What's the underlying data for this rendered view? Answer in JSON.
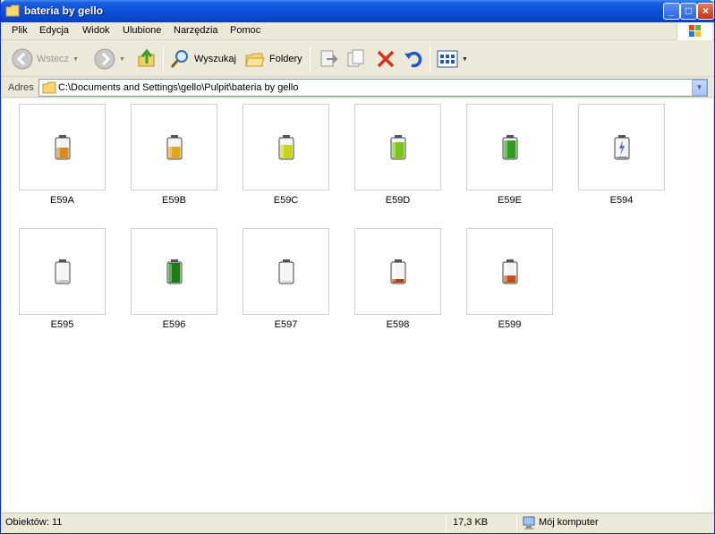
{
  "window": {
    "title": "bateria by gello"
  },
  "menu": {
    "items": [
      "Plik",
      "Edycja",
      "Widok",
      "Ulubione",
      "Narzędzia",
      "Pomoc"
    ]
  },
  "toolbar": {
    "back_label": "Wstecz",
    "search_label": "Wyszukaj",
    "folders_label": "Foldery"
  },
  "address": {
    "label": "Adres",
    "value": "C:\\Documents and Settings\\gello\\Pulpit\\bateria by gello"
  },
  "files": [
    {
      "name": "E59A",
      "fill_color": "#d98a1c",
      "level": 0.55
    },
    {
      "name": "E59B",
      "fill_color": "#e0a41e",
      "level": 0.6
    },
    {
      "name": "E59C",
      "fill_color": "#c8d41a",
      "level": 0.7
    },
    {
      "name": "E59D",
      "fill_color": "#7cc61c",
      "level": 0.8
    },
    {
      "name": "E59E",
      "fill_color": "#2f9f1e",
      "level": 0.9
    },
    {
      "name": "E594",
      "fill_color": "#8a8a8a",
      "level": 0.0
    },
    {
      "name": "E595",
      "fill_color": "#c8c8c8",
      "level": 0.15
    },
    {
      "name": "E596",
      "fill_color": "#1f7a1a",
      "level": 1.0
    },
    {
      "name": "E597",
      "fill_color": "#d8d8d8",
      "level": 0.05
    },
    {
      "name": "E598",
      "fill_color": "#b33a1a",
      "level": 0.2
    },
    {
      "name": "E599",
      "fill_color": "#c0501a",
      "level": 0.35
    }
  ],
  "status": {
    "objects": "Obiektów: 11",
    "size": "17,3 KB",
    "location": "Mój komputer"
  }
}
